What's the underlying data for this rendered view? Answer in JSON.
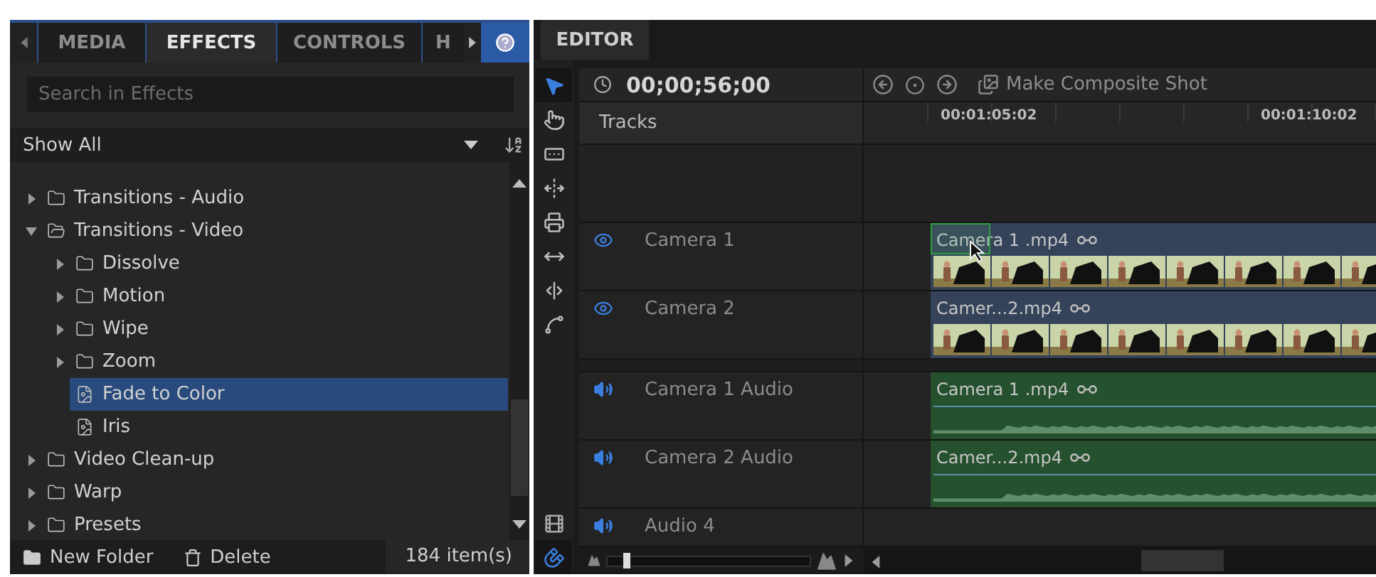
{
  "effects_panel": {
    "tabs": [
      {
        "label": "MEDIA",
        "selected": false
      },
      {
        "label": "EFFECTS",
        "selected": true
      },
      {
        "label": "CONTROLS",
        "selected": false
      },
      {
        "label": "H",
        "selected": false
      }
    ],
    "search": {
      "placeholder": "Search in Effects"
    },
    "filter": "Show All",
    "tree": [
      {
        "label": "Transitions - Audio",
        "kind": "folder",
        "expanded": false,
        "selected": false
      },
      {
        "label": "Transitions - Video",
        "kind": "folder",
        "expanded": true,
        "selected": false,
        "children": [
          {
            "label": "Dissolve",
            "kind": "folder",
            "expanded": false,
            "selected": false
          },
          {
            "label": "Motion",
            "kind": "folder",
            "expanded": false,
            "selected": false
          },
          {
            "label": "Wipe",
            "kind": "folder",
            "expanded": false,
            "selected": false
          },
          {
            "label": "Zoom",
            "kind": "folder",
            "expanded": false,
            "selected": false
          },
          {
            "label": "Fade to Color",
            "kind": "effect",
            "selected": true
          },
          {
            "label": "Iris",
            "kind": "effect",
            "selected": false
          }
        ]
      },
      {
        "label": "Video Clean-up",
        "kind": "folder",
        "expanded": false,
        "selected": false
      },
      {
        "label": "Warp",
        "kind": "folder",
        "expanded": false,
        "selected": false
      },
      {
        "label": "Presets",
        "kind": "folder",
        "expanded": false,
        "selected": false
      }
    ],
    "footer": {
      "new_folder": "New Folder",
      "delete": "Delete",
      "count": "184 item(s)"
    }
  },
  "editor": {
    "tab": "EDITOR",
    "tools": [
      {
        "kind": "pointer",
        "selected": true
      },
      {
        "kind": "hand",
        "selected": false
      },
      {
        "kind": "slip",
        "selected": false
      },
      {
        "kind": "slide",
        "selected": false
      },
      {
        "kind": "roll",
        "selected": false
      },
      {
        "kind": "rate",
        "selected": false
      },
      {
        "kind": "split",
        "selected": false
      },
      {
        "kind": "curve",
        "selected": false
      }
    ],
    "snap": {
      "on": true
    },
    "timecode": "00;00;56;00",
    "composite_button": "Make Composite Shot",
    "tracks_label": "Tracks",
    "ruler": [
      "00:01:05:02",
      "00:01:10:02"
    ],
    "tracks": [
      {
        "name": "Camera 1",
        "kind": "video",
        "clip": "Camera 1 .mp4",
        "hovered": true
      },
      {
        "name": "Camera 2",
        "kind": "video",
        "clip": "Camer...2.mp4",
        "hovered": false
      },
      {
        "name": "Camera 1 Audio",
        "kind": "audio",
        "clip": "Camera 1 .mp4",
        "hovered": false
      },
      {
        "name": "Camera 2 Audio",
        "kind": "audio",
        "clip": "Camer...2.mp4",
        "hovered": false
      },
      {
        "name": "Audio 4",
        "kind": "audio"
      }
    ],
    "zoom": {
      "level": 0.08
    }
  }
}
